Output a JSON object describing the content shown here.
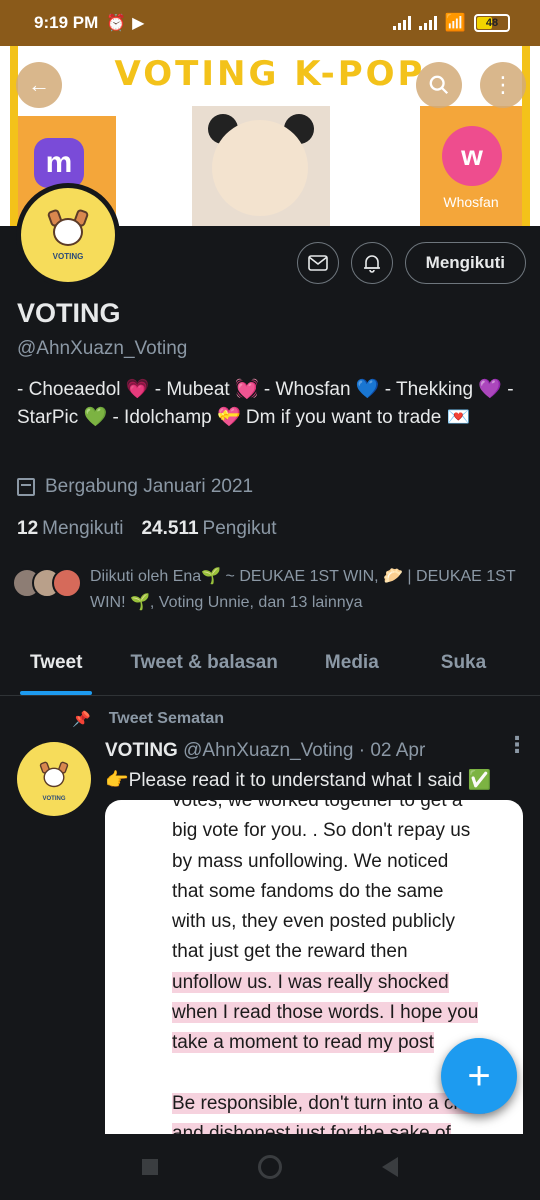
{
  "status": {
    "time": "9:19 PM",
    "battery": "48",
    "battery_level": 0.48
  },
  "banner": {
    "title": "VOTING K-POP",
    "left_app_glyph": "m",
    "right_app_glyph": "w",
    "right_app_label": "Whosfan"
  },
  "avatar": {
    "tag": "VOTING"
  },
  "actions": {
    "follow_label": "Mengikuti"
  },
  "profile": {
    "name": "VOTING",
    "handle": "@AhnXuazn_Voting",
    "bio": "- Choeaedol 💗 - Mubeat 💓 - Whosfan 💙 - Thekking 💜 - StarPic 💚 - Idolchamp 💝  Dm if you want to trade 💌",
    "joined": "Bergabung Januari 2021",
    "following_count": "12",
    "following_label": "Mengikuti",
    "followers_count": "24.511",
    "followers_label": "Pengikut",
    "followed_by": "Diikuti oleh Ena🌱 ~ DEUKAE 1ST WIN, 🥟 | DEUKAE 1ST WIN! 🌱, Voting Unnie, dan 13 lainnya"
  },
  "tabs": [
    {
      "label": "Tweet"
    },
    {
      "label": "Tweet & balasan"
    },
    {
      "label": "Media"
    },
    {
      "label": "Suka"
    }
  ],
  "tweet": {
    "pinned_label": "Tweet Sematan",
    "name": "VOTING",
    "meta": "@AhnXuazn_Voting · 02 Apr",
    "text": "👉Please read it to understand what I said ✅",
    "media_lines": [
      {
        "text": "votes, we worked together to get a",
        "hl": false
      },
      {
        "text": "big vote for you. . So don't repay us",
        "hl": false
      },
      {
        "text": "by mass unfollowing. We noticed",
        "hl": false
      },
      {
        "text": "that some fandoms do the same",
        "hl": false
      },
      {
        "text": "with us, they even posted publicly",
        "hl": false
      },
      {
        "text": "that just get the reward then",
        "hl": false
      },
      {
        "text": "unfollow us. I was really shocked",
        "hl": true
      },
      {
        "text": "when I read those words. I hope you",
        "hl": true
      },
      {
        "text": "take a moment to read my post",
        "hl": true
      },
      {
        "text": "",
        "hl": false
      },
      {
        "text": " Be responsible, don't turn into a cruel",
        "hl": true
      },
      {
        "text": "and dishonest just for the sake of",
        "hl": true
      }
    ]
  },
  "fab": {
    "glyph": "+"
  },
  "colors": {
    "accent": "#1d9bf0",
    "status_bar": "#8a5a1a",
    "banner_yellow": "#f3c21a",
    "background": "#15171a"
  }
}
